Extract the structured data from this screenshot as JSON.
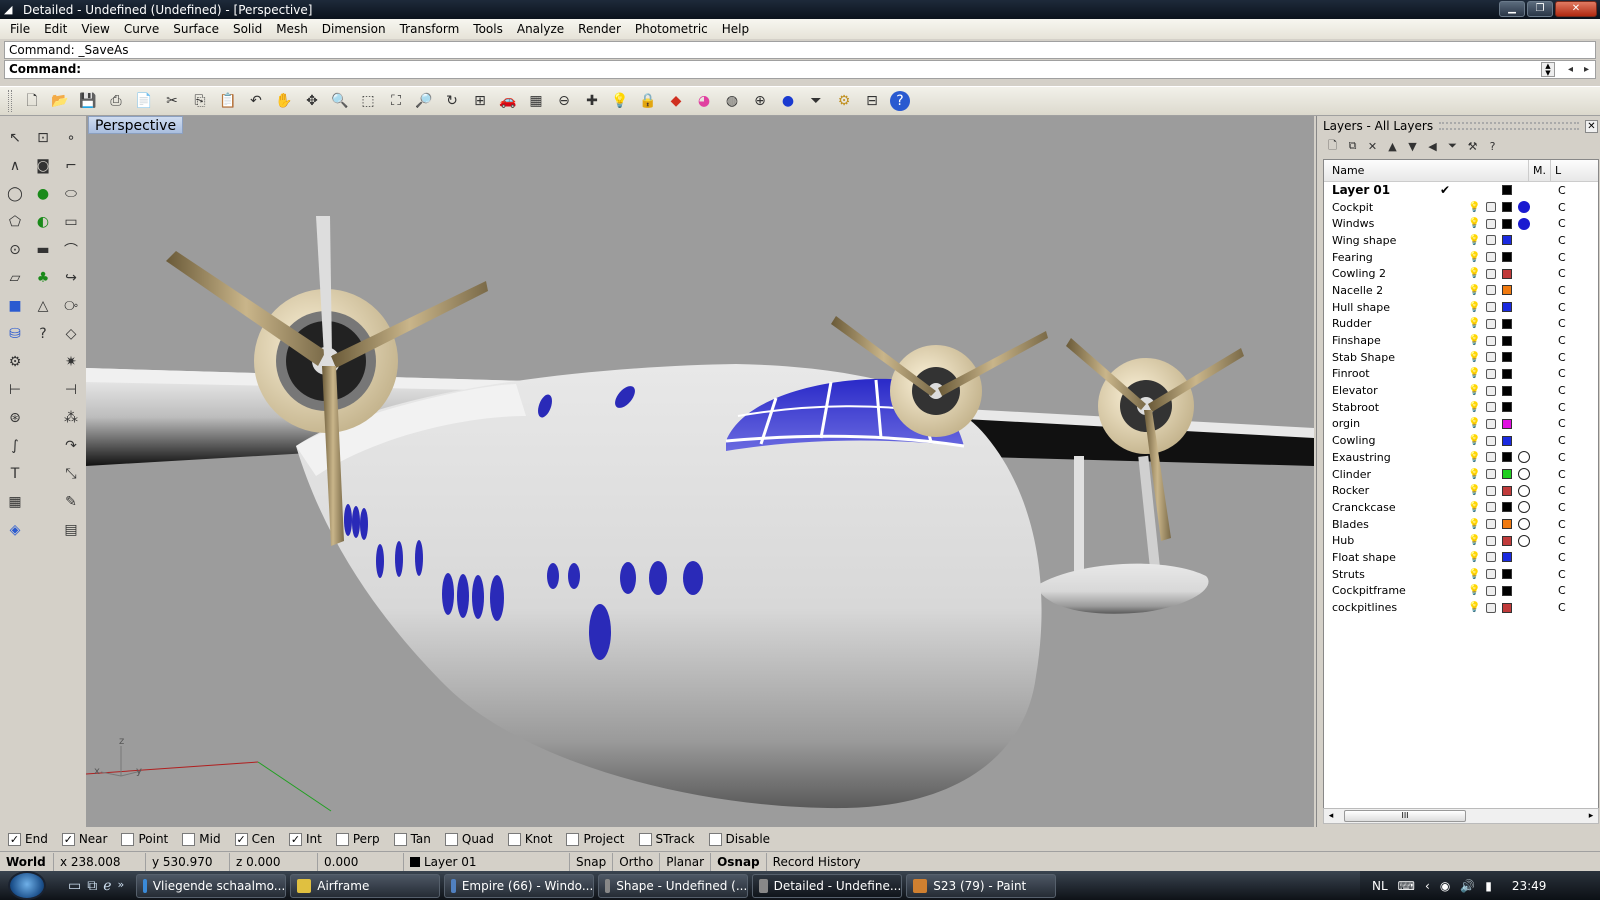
{
  "window": {
    "title": "Detailed - Undefined (Undefined) - [Perspective]"
  },
  "menu": [
    "File",
    "Edit",
    "View",
    "Curve",
    "Surface",
    "Solid",
    "Mesh",
    "Dimension",
    "Transform",
    "Tools",
    "Analyze",
    "Render",
    "Photometric",
    "Help"
  ],
  "command": {
    "history": "Command: _SaveAs",
    "prompt": "Command:"
  },
  "toolbar_icons": [
    "new-icon",
    "open-icon",
    "save-icon",
    "print-icon",
    "import-icon",
    "cut-icon",
    "copy-icon",
    "paste-icon",
    "undo-icon",
    "pan-icon",
    "rotate-view-icon",
    "zoom-icon",
    "zoom-window-icon",
    "zoom-extents-icon",
    "zoom-selected-icon",
    "rotate-icon",
    "viewport-layout-icon",
    "car-icon",
    "grid-icon",
    "circle-icon",
    "snap-point-icon",
    "light-icon",
    "lock-icon",
    "render-icon",
    "color-wheel-icon",
    "sphere-wire-icon",
    "globe-icon",
    "shaded-sphere-icon",
    "filter-icon",
    "options-gear-icon",
    "properties-icon",
    "help-icon"
  ],
  "viewport": {
    "label": "Perspective",
    "axis": {
      "x": "x",
      "y": "y",
      "z": "z"
    }
  },
  "layers": {
    "title": "Layers - All Layers",
    "columns": {
      "name": "Name",
      "material": "M.",
      "linetype": "L"
    },
    "rows": [
      {
        "name": "Layer 01",
        "current": true,
        "color": "#000000",
        "material": "",
        "bulb": "#d4b400",
        "lt": "C"
      },
      {
        "name": "Cockpit",
        "color": "#000000",
        "material": "#1a1ad0",
        "bulb": "#d4b400",
        "lt": "C"
      },
      {
        "name": "Windws",
        "color": "#000000",
        "material": "#1a1ad0",
        "bulb": "#d4b400",
        "lt": "C"
      },
      {
        "name": "Wing shape",
        "color": "#1a2ae0",
        "material": "",
        "bulb": "#d4b400",
        "lt": "C"
      },
      {
        "name": "Fearing",
        "color": "#000000",
        "material": "",
        "bulb": "#d4b400",
        "lt": "C"
      },
      {
        "name": "Cowling 2",
        "color": "#c03a3a",
        "material": "",
        "bulb": "#3a7ad0",
        "lt": "C"
      },
      {
        "name": "Nacelle 2",
        "color": "#f07a10",
        "material": "",
        "bulb": "#d4b400",
        "lt": "C"
      },
      {
        "name": "Hull shape",
        "color": "#1a2ae0",
        "material": "",
        "bulb": "#d4b400",
        "lt": "C"
      },
      {
        "name": "Rudder",
        "color": "#000000",
        "material": "",
        "bulb": "#d4b400",
        "lt": "C"
      },
      {
        "name": "Finshape",
        "color": "#000000",
        "material": "",
        "bulb": "#d4b400",
        "lt": "C"
      },
      {
        "name": "Stab Shape",
        "color": "#000000",
        "material": "",
        "bulb": "#d4b400",
        "lt": "C"
      },
      {
        "name": "Finroot",
        "color": "#000000",
        "material": "",
        "bulb": "#d4b400",
        "lt": "C"
      },
      {
        "name": "Elevator",
        "color": "#000000",
        "material": "",
        "bulb": "#d4b400",
        "lt": "C"
      },
      {
        "name": "Stabroot",
        "color": "#000000",
        "material": "",
        "bulb": "#d4b400",
        "lt": "C"
      },
      {
        "name": "orgin",
        "color": "#e010e0",
        "material": "",
        "bulb": "#d4b400",
        "lt": "C"
      },
      {
        "name": "Cowling",
        "color": "#1a2ae0",
        "material": "",
        "bulb": "#d4b400",
        "lt": "C"
      },
      {
        "name": "Exaustring",
        "color": "#000000",
        "material": "ring",
        "bulb": "#d4b400",
        "lt": "C"
      },
      {
        "name": "Clinder",
        "color": "#20d020",
        "material": "ring",
        "bulb": "#d4b400",
        "lt": "C"
      },
      {
        "name": "Rocker",
        "color": "#c03a3a",
        "material": "ring",
        "bulb": "#d4b400",
        "lt": "C"
      },
      {
        "name": "Cranckcase",
        "color": "#000000",
        "material": "ring",
        "bulb": "#d4b400",
        "lt": "C"
      },
      {
        "name": "Blades",
        "color": "#f07a10",
        "material": "ring",
        "bulb": "#d4b400",
        "lt": "C"
      },
      {
        "name": "Hub",
        "color": "#c03a3a",
        "material": "ring",
        "bulb": "#d4b400",
        "lt": "C"
      },
      {
        "name": "Float shape",
        "color": "#1a2ae0",
        "material": "",
        "bulb": "#d4b400",
        "lt": "C"
      },
      {
        "name": "Struts",
        "color": "#000000",
        "material": "",
        "bulb": "#d4b400",
        "lt": "C"
      },
      {
        "name": "Cockpitframe",
        "color": "#000000",
        "material": "",
        "bulb": "#d4b400",
        "lt": "C"
      },
      {
        "name": "cockpitlines",
        "color": "#c03a3a",
        "material": "",
        "bulb": "#d4b400",
        "lt": "C"
      }
    ],
    "scroll_label": "III"
  },
  "osnap": [
    {
      "label": "End",
      "checked": true
    },
    {
      "label": "Near",
      "checked": true
    },
    {
      "label": "Point",
      "checked": false
    },
    {
      "label": "Mid",
      "checked": false
    },
    {
      "label": "Cen",
      "checked": true
    },
    {
      "label": "Int",
      "checked": true
    },
    {
      "label": "Perp",
      "checked": false
    },
    {
      "label": "Tan",
      "checked": false
    },
    {
      "label": "Quad",
      "checked": false
    },
    {
      "label": "Knot",
      "checked": false
    },
    {
      "label": "Project",
      "checked": false
    },
    {
      "label": "STrack",
      "checked": false
    },
    {
      "label": "Disable",
      "checked": false
    }
  ],
  "status": {
    "cplane": "World",
    "x": "x 238.008",
    "y": "y 530.970",
    "z": "z 0.000",
    "d": "0.000",
    "layer": "Layer 01",
    "snap": "Snap",
    "ortho": "Ortho",
    "planar": "Planar",
    "osnap": "Osnap",
    "history": "Record History"
  },
  "taskbar": {
    "tasks": [
      {
        "label": "Vliegende schaalmo...",
        "icon": "ie-icon",
        "color": "#3a8ad8"
      },
      {
        "label": "Airframe",
        "icon": "folder-icon",
        "color": "#e0c040"
      },
      {
        "label": "Empire (66) - Windo...",
        "icon": "image-icon",
        "color": "#5080c0"
      },
      {
        "label": "Shape - Undefined (...",
        "icon": "rhino-icon",
        "color": "#888"
      },
      {
        "label": "Detailed - Undefine...",
        "icon": "rhino-icon",
        "color": "#888",
        "active": true
      },
      {
        "label": "S23 (79) - Paint",
        "icon": "paint-icon",
        "color": "#d08030"
      }
    ],
    "lang": "NL",
    "time": "23:49"
  }
}
